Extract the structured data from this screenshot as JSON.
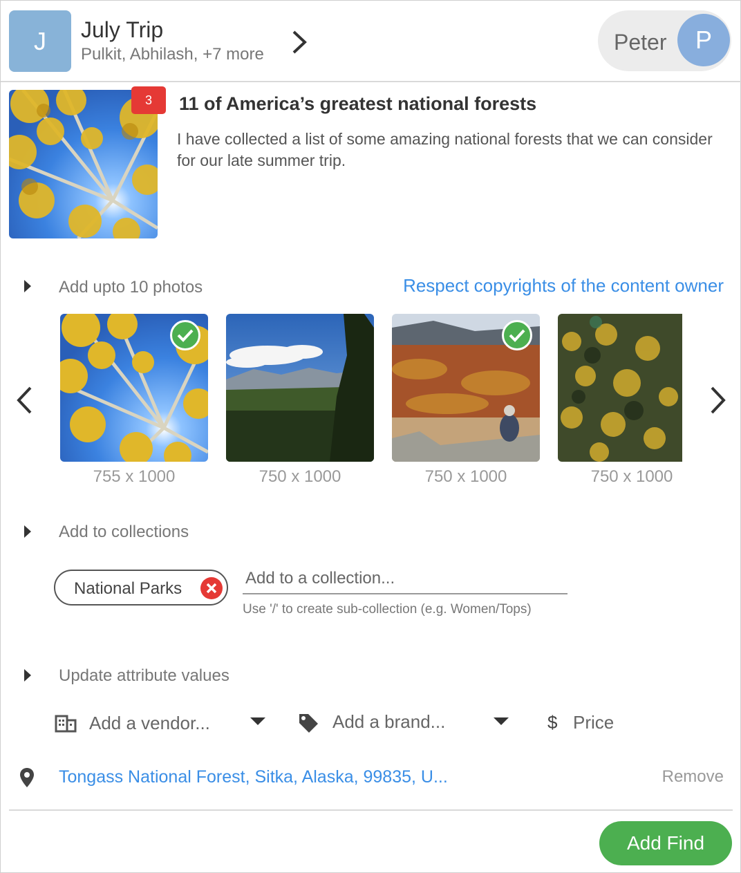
{
  "header": {
    "group_initial": "J",
    "group_title": "July Trip",
    "group_members": "Pulkit, Abhilash, +7 more",
    "user_name": "Peter",
    "user_initial": "P"
  },
  "article": {
    "badge_count": "3",
    "title": "11 of America’s greatest national forests",
    "description": "I have collected a list of some amazing national forests that we can consider for our late summer trip."
  },
  "photos": {
    "section_label": "Add upto 10 photos",
    "copyright_link": "Respect copyrights of the content owner",
    "items": [
      {
        "dimensions": "755 x 1000",
        "selected": true,
        "subject": "aspen canopy"
      },
      {
        "dimensions": "750 x 1000",
        "selected": false,
        "subject": "mountain valley"
      },
      {
        "dimensions": "750 x 1000",
        "selected": true,
        "subject": "autumn hillside with hiker"
      },
      {
        "dimensions": "750 x 1000",
        "selected": false,
        "subject": "autumn forest"
      }
    ]
  },
  "collections": {
    "section_label": "Add to collections",
    "chips": [
      "National Parks"
    ],
    "input_placeholder": "Add to a collection...",
    "hint": "Use '/' to create sub-collection (e.g. Women/Tops)"
  },
  "attributes": {
    "section_label": "Update attribute values",
    "vendor_placeholder": "Add a vendor...",
    "brand_placeholder": "Add a brand...",
    "price_symbol": "$",
    "price_placeholder": "Price"
  },
  "location": {
    "text": "Tongass National Forest, Sitka, Alaska, 99835, U...",
    "remove_label": "Remove"
  },
  "footer": {
    "add_button": "Add Find"
  },
  "colors": {
    "accent_blue": "#3a8ee6",
    "success_green": "#4caf50",
    "danger_red": "#e53935",
    "group_avatar": "#88b3d8"
  }
}
